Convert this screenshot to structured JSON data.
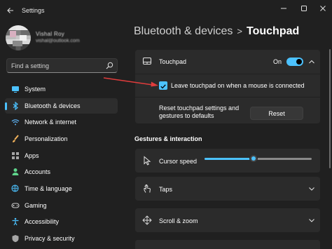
{
  "window": {
    "title": "Settings",
    "back_icon": "back-arrow-icon",
    "controls": [
      "minimize-icon",
      "maximize-icon",
      "close-icon"
    ]
  },
  "profile": {
    "name": "Vishal Roy",
    "email": "vishal@outlook.com"
  },
  "search": {
    "placeholder": "Find a setting",
    "icon": "search-icon"
  },
  "nav": {
    "items": [
      {
        "label": "System",
        "icon": "monitor-icon",
        "color": "#4cc2ff"
      },
      {
        "label": "Bluetooth & devices",
        "icon": "bluetooth-icon",
        "color": "#4cc2ff",
        "active": true
      },
      {
        "label": "Network & internet",
        "icon": "wifi-icon",
        "color": "#5fb2f2"
      },
      {
        "label": "Personalization",
        "icon": "brush-icon",
        "color": "#f2b35c"
      },
      {
        "label": "Apps",
        "icon": "apps-icon",
        "color": "#a6a6a6"
      },
      {
        "label": "Accounts",
        "icon": "person-icon",
        "color": "#5fd48b"
      },
      {
        "label": "Time & language",
        "icon": "globe-clock-icon",
        "color": "#4cc2ff"
      },
      {
        "label": "Gaming",
        "icon": "gamepad-icon",
        "color": "#d0d0d0"
      },
      {
        "label": "Accessibility",
        "icon": "accessibility-icon",
        "color": "#4cc2ff"
      },
      {
        "label": "Privacy & security",
        "icon": "shield-icon",
        "color": "#a6a6a6"
      }
    ]
  },
  "header": {
    "parent": "Bluetooth & devices",
    "separator": ">",
    "current": "Touchpad"
  },
  "touchpad": {
    "label": "Touchpad",
    "icon": "touchpad-icon",
    "toggle_state": "On",
    "toggle_on": true,
    "leave_on_label": "Leave touchpad on when a mouse is connected",
    "leave_on_checked": true,
    "reset_label": "Reset touchpad settings and gestures to defaults",
    "reset_button": "Reset"
  },
  "gestures": {
    "section_title": "Gestures & interaction",
    "cursor_speed_label": "Cursor speed",
    "cursor_speed_fraction": 0.46,
    "taps_label": "Taps",
    "scroll_zoom_label": "Scroll & zoom"
  },
  "colors": {
    "accent": "#4cc2ff",
    "annotation_arrow": "#e03c3c",
    "background": "#202020",
    "card": "#2b2b2b"
  }
}
